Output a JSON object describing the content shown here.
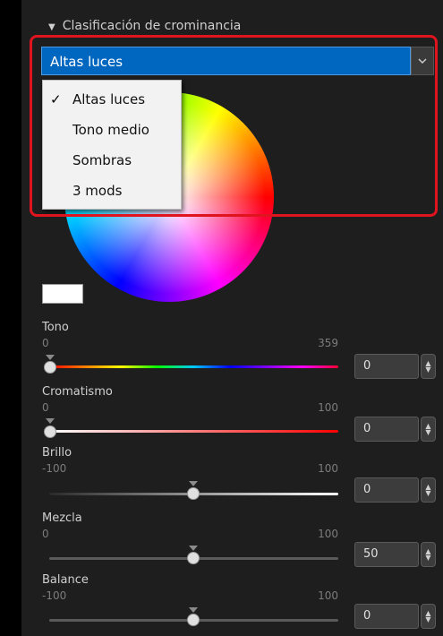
{
  "section": {
    "title": "Clasificación de crominancia",
    "toggle_icon": "triangle-down-icon"
  },
  "dropdown": {
    "selected": "Altas luces",
    "options": [
      {
        "label": "Altas luces",
        "checked": true
      },
      {
        "label": "Tono medio",
        "checked": false
      },
      {
        "label": "Sombras",
        "checked": false
      },
      {
        "label": "3 mods",
        "checked": false
      }
    ],
    "check_icon": "✓"
  },
  "colors": {
    "highlight": "#e0141e",
    "select_bg": "#0067c0",
    "panel_bg": "#1e1e1e"
  },
  "sliders": [
    {
      "label": "Tono",
      "min": "0",
      "max": "359",
      "value": "0"
    },
    {
      "label": "Cromatismo",
      "min": "0",
      "max": "100",
      "value": "0"
    },
    {
      "label": "Brillo",
      "min": "-100",
      "max": "100",
      "value": "0"
    },
    {
      "label": "Mezcla",
      "min": "0",
      "max": "100",
      "value": "50"
    },
    {
      "label": "Balance",
      "min": "-100",
      "max": "100",
      "value": "0"
    }
  ]
}
